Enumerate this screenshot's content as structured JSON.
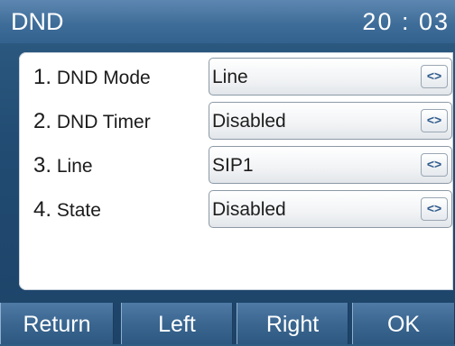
{
  "header": {
    "title": "DND",
    "clock": "20 : 03"
  },
  "rows": [
    {
      "num": "1.",
      "label": "DND Mode",
      "value": "Line",
      "arrow": "<>"
    },
    {
      "num": "2.",
      "label": "DND Timer",
      "value": "Disabled",
      "arrow": "<>"
    },
    {
      "num": "3.",
      "label": "Line",
      "value": "SIP1",
      "arrow": "<>"
    },
    {
      "num": "4.",
      "label": "State",
      "value": "Disabled",
      "arrow": "<>"
    }
  ],
  "softkeys": [
    "Return",
    "Left",
    "Right",
    "OK"
  ]
}
